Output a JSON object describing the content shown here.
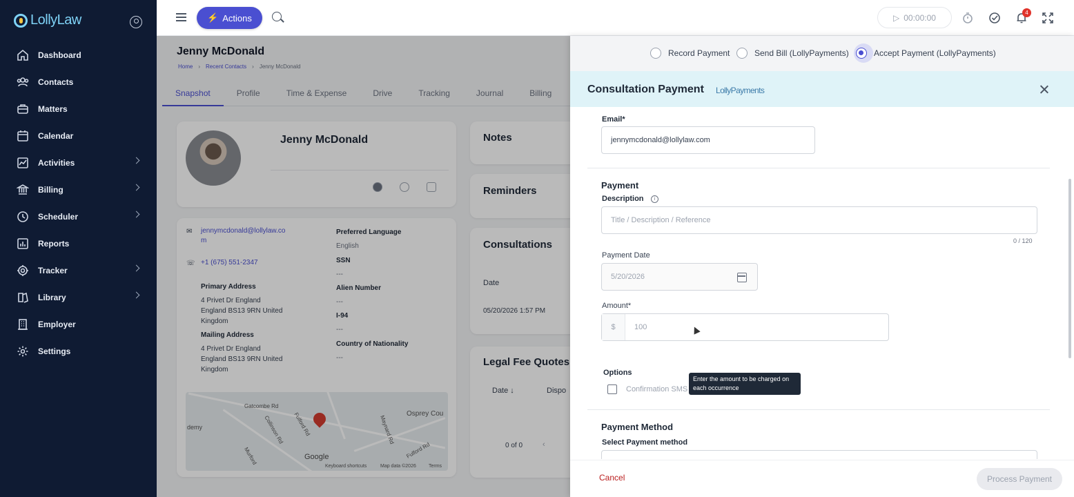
{
  "app": {
    "logo": "LollyLaw"
  },
  "sidebar": {
    "items": [
      {
        "label": "Dashboard",
        "icon": "home-icon",
        "has_sub": false
      },
      {
        "label": "Contacts",
        "icon": "contacts-icon",
        "has_sub": false
      },
      {
        "label": "Matters",
        "icon": "briefcase-icon",
        "has_sub": false
      },
      {
        "label": "Calendar",
        "icon": "calendar-icon",
        "has_sub": false
      },
      {
        "label": "Activities",
        "icon": "activity-icon",
        "has_sub": true
      },
      {
        "label": "Billing",
        "icon": "bank-icon",
        "has_sub": true
      },
      {
        "label": "Scheduler",
        "icon": "clock-icon",
        "has_sub": true
      },
      {
        "label": "Reports",
        "icon": "chart-icon",
        "has_sub": false
      },
      {
        "label": "Tracker",
        "icon": "target-icon",
        "has_sub": true
      },
      {
        "label": "Library",
        "icon": "library-icon",
        "has_sub": true
      },
      {
        "label": "Employer",
        "icon": "building-icon",
        "has_sub": false
      },
      {
        "label": "Settings",
        "icon": "gear-icon",
        "has_sub": false
      }
    ]
  },
  "topbar": {
    "actions_label": "Actions",
    "timer": "00:00:00",
    "notification_count": "4"
  },
  "main": {
    "client_name": "Jenny McDonald",
    "breadcrumbs": [
      "Home",
      "Recent Contacts",
      "Jenny McDonald"
    ],
    "tabs": [
      "Snapshot",
      "Profile",
      "Time & Expense",
      "Drive",
      "Tracking",
      "Journal",
      "Billing"
    ],
    "profile": {
      "name": "Jenny McDonald",
      "email_line1": "jennymcdonald@lollylaw.co",
      "email_line2": "m",
      "phone": "+1 (675) 551-2347",
      "primary_address_label": "Primary Address",
      "primary_address": [
        "4 Privet Dr England",
        "England BS13 9RN United",
        "Kingdom"
      ],
      "mailing_address_label": "Mailing Address",
      "mailing_address": [
        "4 Privet Dr England",
        "England BS13 9RN United",
        "Kingdom"
      ],
      "preferred_language_label": "Preferred Language",
      "preferred_language": "English",
      "ssn_label": "SSN",
      "ssn": "---",
      "alien_number_label": "Alien Number",
      "alien_number": "---",
      "i94_label": "I-94",
      "i94": "---",
      "country_label": "Country of Nationality",
      "country": "---"
    },
    "map": {
      "labels": [
        "Gatcombe Rd",
        "Fulford Rd",
        "Collinson Rd",
        "Murford",
        "Osprey Cou",
        "Maynard Rd",
        "Fulford Rd",
        "demy",
        "Google",
        "Keyboard shortcuts",
        "Map data ©2026",
        "Terms"
      ]
    },
    "notes_title": "Notes",
    "reminders_title": "Reminders",
    "consultations_title": "Consultations",
    "consult_date_label": "Date",
    "consult_date_value": "05/20/2026 1:57 PM",
    "legal_fee_title": "Legal Fee Quotes",
    "legal_fee_date_col": "Date ↓",
    "legal_fee_dispo_col": "Dispo",
    "pagination": "0 of 0"
  },
  "drawer": {
    "radio_options": [
      "Record Payment",
      "Send Bill (LollyPayments)",
      "Accept Payment (LollyPayments)"
    ],
    "selected_index": 2,
    "title": "Consultation Payment",
    "brand_logo": "LollyPayments",
    "email_label": "Email*",
    "email_value": "jennymcdonald@lollylaw.com",
    "payment_heading": "Payment",
    "description_label": "Description",
    "description_placeholder": "Title / Description / Reference",
    "description_counter": "0 / 120",
    "payment_date_label": "Payment Date",
    "payment_date_value": "5/20/2026",
    "amount_label": "Amount*",
    "amount_currency": "$",
    "amount_placeholder": "100",
    "options_heading": "Options",
    "confirmation_label": "Confirmation SMS",
    "tooltip_text": "Enter the amount to be charged on each occurrence",
    "payment_method_heading": "Payment Method",
    "select_payment_label": "Select Payment method",
    "cancel_label": "Cancel",
    "process_label": "Process Payment"
  },
  "colors": {
    "sidebar_bg": "#0f1b33",
    "accent": "#4a4fd1",
    "drawer_header": "#dff3f8",
    "danger": "#b91c1c"
  }
}
